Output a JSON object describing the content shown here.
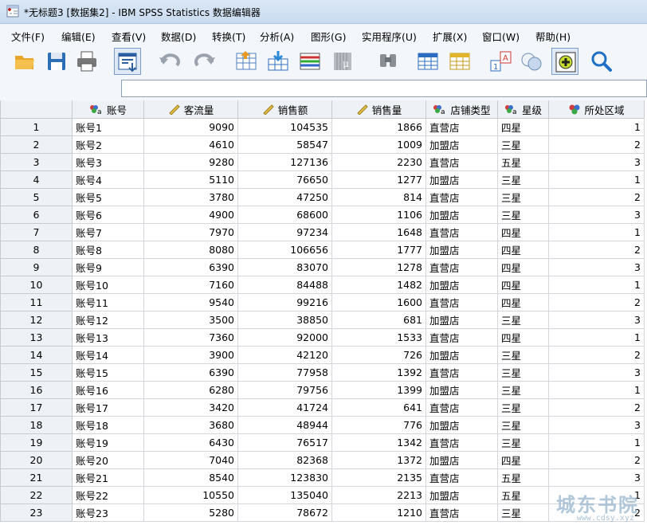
{
  "window": {
    "title": "*无标题3 [数据集2] - IBM SPSS Statistics 数据编辑器"
  },
  "menu": [
    "文件(F)",
    "编辑(E)",
    "查看(V)",
    "数据(D)",
    "转换(T)",
    "分析(A)",
    "图形(G)",
    "实用程序(U)",
    "扩展(X)",
    "窗口(W)",
    "帮助(H)"
  ],
  "toolbar": {
    "icons": [
      "open-folder-icon",
      "save-icon",
      "print-icon",
      "dialog-recall-icon",
      "undo-icon",
      "redo-icon",
      "goto-case-icon",
      "goto-variable-icon",
      "variables-icon",
      "run-descriptives-icon",
      "find-icon",
      "insert-cases-icon",
      "insert-variable-icon",
      "split-file-icon",
      "weight-cases-icon",
      "select-cases-icon",
      "value-labels-icon",
      "use-variable-sets-icon",
      "search-icon"
    ]
  },
  "cell_editor": {
    "value": ""
  },
  "columns": [
    {
      "name": "账号",
      "type": "nominal-string"
    },
    {
      "name": "客流量",
      "type": "scale"
    },
    {
      "name": "销售额",
      "type": "scale"
    },
    {
      "name": "销售量",
      "type": "scale"
    },
    {
      "name": "店铺类型",
      "type": "nominal-string"
    },
    {
      "name": "星级",
      "type": "nominal-string"
    },
    {
      "name": "所处区域",
      "type": "nominal"
    }
  ],
  "rows": [
    [
      "1",
      "账号1",
      "9090",
      "104535",
      "1866",
      "直营店",
      "四星",
      "1"
    ],
    [
      "2",
      "账号2",
      "4610",
      "58547",
      "1009",
      "加盟店",
      "三星",
      "2"
    ],
    [
      "3",
      "账号3",
      "9280",
      "127136",
      "2230",
      "直营店",
      "五星",
      "3"
    ],
    [
      "4",
      "账号4",
      "5110",
      "76650",
      "1277",
      "加盟店",
      "三星",
      "1"
    ],
    [
      "5",
      "账号5",
      "3780",
      "47250",
      "814",
      "直营店",
      "三星",
      "2"
    ],
    [
      "6",
      "账号6",
      "4900",
      "68600",
      "1106",
      "加盟店",
      "三星",
      "3"
    ],
    [
      "7",
      "账号7",
      "7970",
      "97234",
      "1648",
      "直营店",
      "四星",
      "1"
    ],
    [
      "8",
      "账号8",
      "8080",
      "106656",
      "1777",
      "加盟店",
      "四星",
      "2"
    ],
    [
      "9",
      "账号9",
      "6390",
      "83070",
      "1278",
      "直营店",
      "四星",
      "3"
    ],
    [
      "10",
      "账号10",
      "7160",
      "84488",
      "1482",
      "加盟店",
      "四星",
      "1"
    ],
    [
      "11",
      "账号11",
      "9540",
      "99216",
      "1600",
      "直营店",
      "四星",
      "2"
    ],
    [
      "12",
      "账号12",
      "3500",
      "38850",
      "681",
      "加盟店",
      "三星",
      "3"
    ],
    [
      "13",
      "账号13",
      "7360",
      "92000",
      "1533",
      "直营店",
      "四星",
      "1"
    ],
    [
      "14",
      "账号14",
      "3900",
      "42120",
      "726",
      "加盟店",
      "三星",
      "2"
    ],
    [
      "15",
      "账号15",
      "6390",
      "77958",
      "1392",
      "直营店",
      "三星",
      "3"
    ],
    [
      "16",
      "账号16",
      "6280",
      "79756",
      "1399",
      "加盟店",
      "三星",
      "1"
    ],
    [
      "17",
      "账号17",
      "3420",
      "41724",
      "641",
      "直营店",
      "三星",
      "2"
    ],
    [
      "18",
      "账号18",
      "3680",
      "48944",
      "776",
      "加盟店",
      "三星",
      "3"
    ],
    [
      "19",
      "账号19",
      "6430",
      "76517",
      "1342",
      "直营店",
      "三星",
      "1"
    ],
    [
      "20",
      "账号20",
      "7040",
      "82368",
      "1372",
      "加盟店",
      "四星",
      "2"
    ],
    [
      "21",
      "账号21",
      "8540",
      "123830",
      "2135",
      "直营店",
      "五星",
      "3"
    ],
    [
      "22",
      "账号22",
      "10550",
      "135040",
      "2213",
      "加盟店",
      "五星",
      "1"
    ],
    [
      "23",
      "账号23",
      "5280",
      "78672",
      "1210",
      "直营店",
      "三星",
      "2"
    ]
  ],
  "watermark": {
    "text": "城东书院",
    "url": "www.cdsy.xyz"
  }
}
